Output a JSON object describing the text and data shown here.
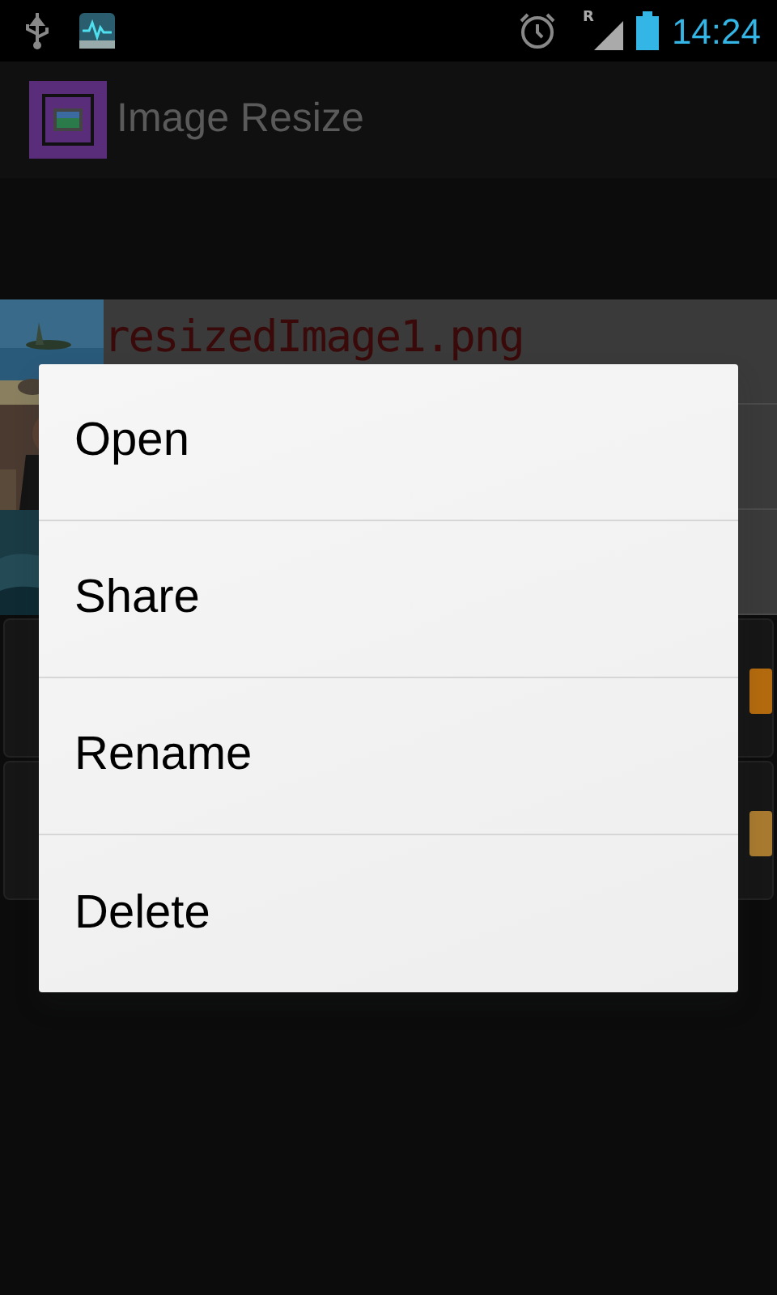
{
  "status_bar": {
    "time": "14:24",
    "roaming_mark": "R"
  },
  "action_bar": {
    "title": "Image Resize"
  },
  "files": [
    {
      "name": "resizedImage1.png",
      "kind": "picture"
    },
    {
      "kind": "picture"
    },
    {
      "kind": "picture"
    }
  ],
  "context_menu": {
    "items": [
      {
        "label": "Open"
      },
      {
        "label": "Share"
      },
      {
        "label": "Rename"
      },
      {
        "label": "Delete"
      }
    ]
  }
}
